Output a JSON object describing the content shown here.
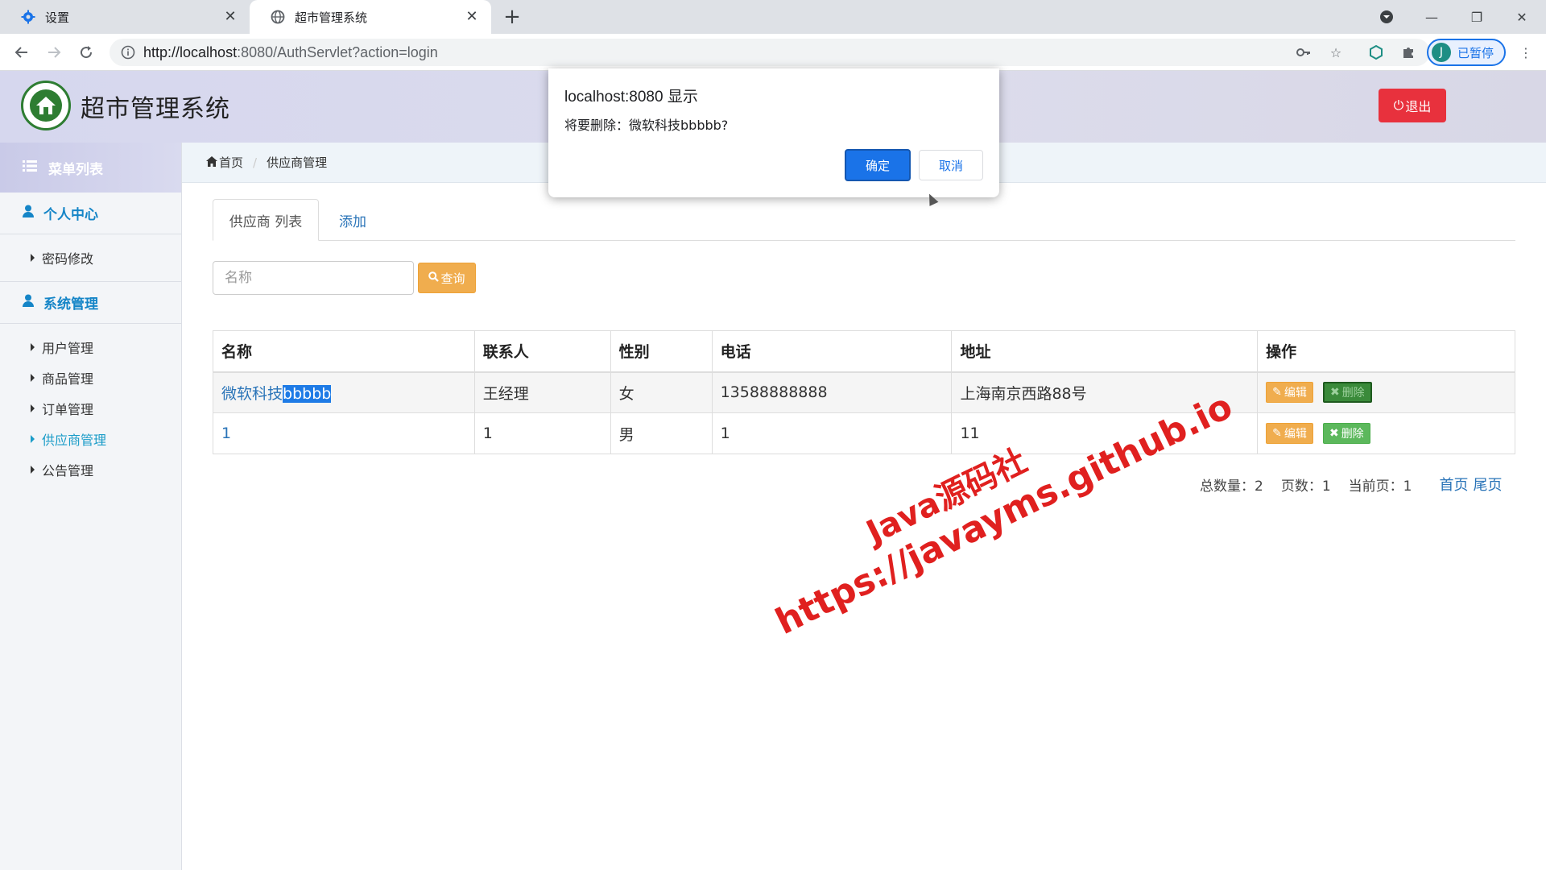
{
  "browser": {
    "tabs": [
      {
        "title": "设置",
        "icon": "gear-icon"
      },
      {
        "title": "超市管理系统",
        "icon": "globe-icon"
      }
    ],
    "url_host": "http://localhost",
    "url_rest": ":8080/AuthServlet?action=login",
    "profile_initial": "J",
    "profile_label": "已暂停"
  },
  "app": {
    "title": "超市管理系统",
    "logout_label": "退出"
  },
  "sidebar": {
    "menu_title": "菜单列表",
    "groups": [
      {
        "title": "个人中心",
        "items": [
          {
            "label": "密码修改"
          }
        ]
      },
      {
        "title": "系统管理",
        "items": [
          {
            "label": "用户管理"
          },
          {
            "label": "商品管理"
          },
          {
            "label": "订单管理"
          },
          {
            "label": "供应商管理",
            "active": true
          },
          {
            "label": "公告管理"
          }
        ]
      }
    ]
  },
  "breadcrumb": {
    "home": "首页",
    "current": "供应商管理"
  },
  "tabs": {
    "list": "供应商 列表",
    "add": "添加"
  },
  "search": {
    "placeholder": "名称",
    "button": "查询"
  },
  "table": {
    "headers": [
      "名称",
      "联系人",
      "性别",
      "电话",
      "地址",
      "操作"
    ],
    "rows": [
      {
        "name_a": "微软科技",
        "name_b": "bbbbb",
        "contact": "王经理",
        "gender": "女",
        "phone": "13588888888",
        "address": "上海南京西路88号"
      },
      {
        "name_a": "1",
        "name_b": "",
        "contact": "1",
        "gender": "男",
        "phone": "1",
        "address": "11"
      }
    ],
    "edit_label": "编辑",
    "delete_label": "删除"
  },
  "pager": {
    "total": "总数量：2",
    "pages": "页数：1",
    "current": "当前页：1",
    "first": "首页",
    "last": "尾页"
  },
  "watermark": {
    "line1": "Java源码社",
    "line2": "https://javayms.github.io"
  },
  "dialog": {
    "origin": "localhost:8080 显示",
    "message": "将要删除：微软科技bbbbb?",
    "ok": "确定",
    "cancel": "取消"
  },
  "colors": {
    "accent": "#1585c7",
    "danger": "#e8313d",
    "warning": "#f0ad4e",
    "success": "#5cb85c",
    "dialog_primary": "#1a73e8"
  }
}
